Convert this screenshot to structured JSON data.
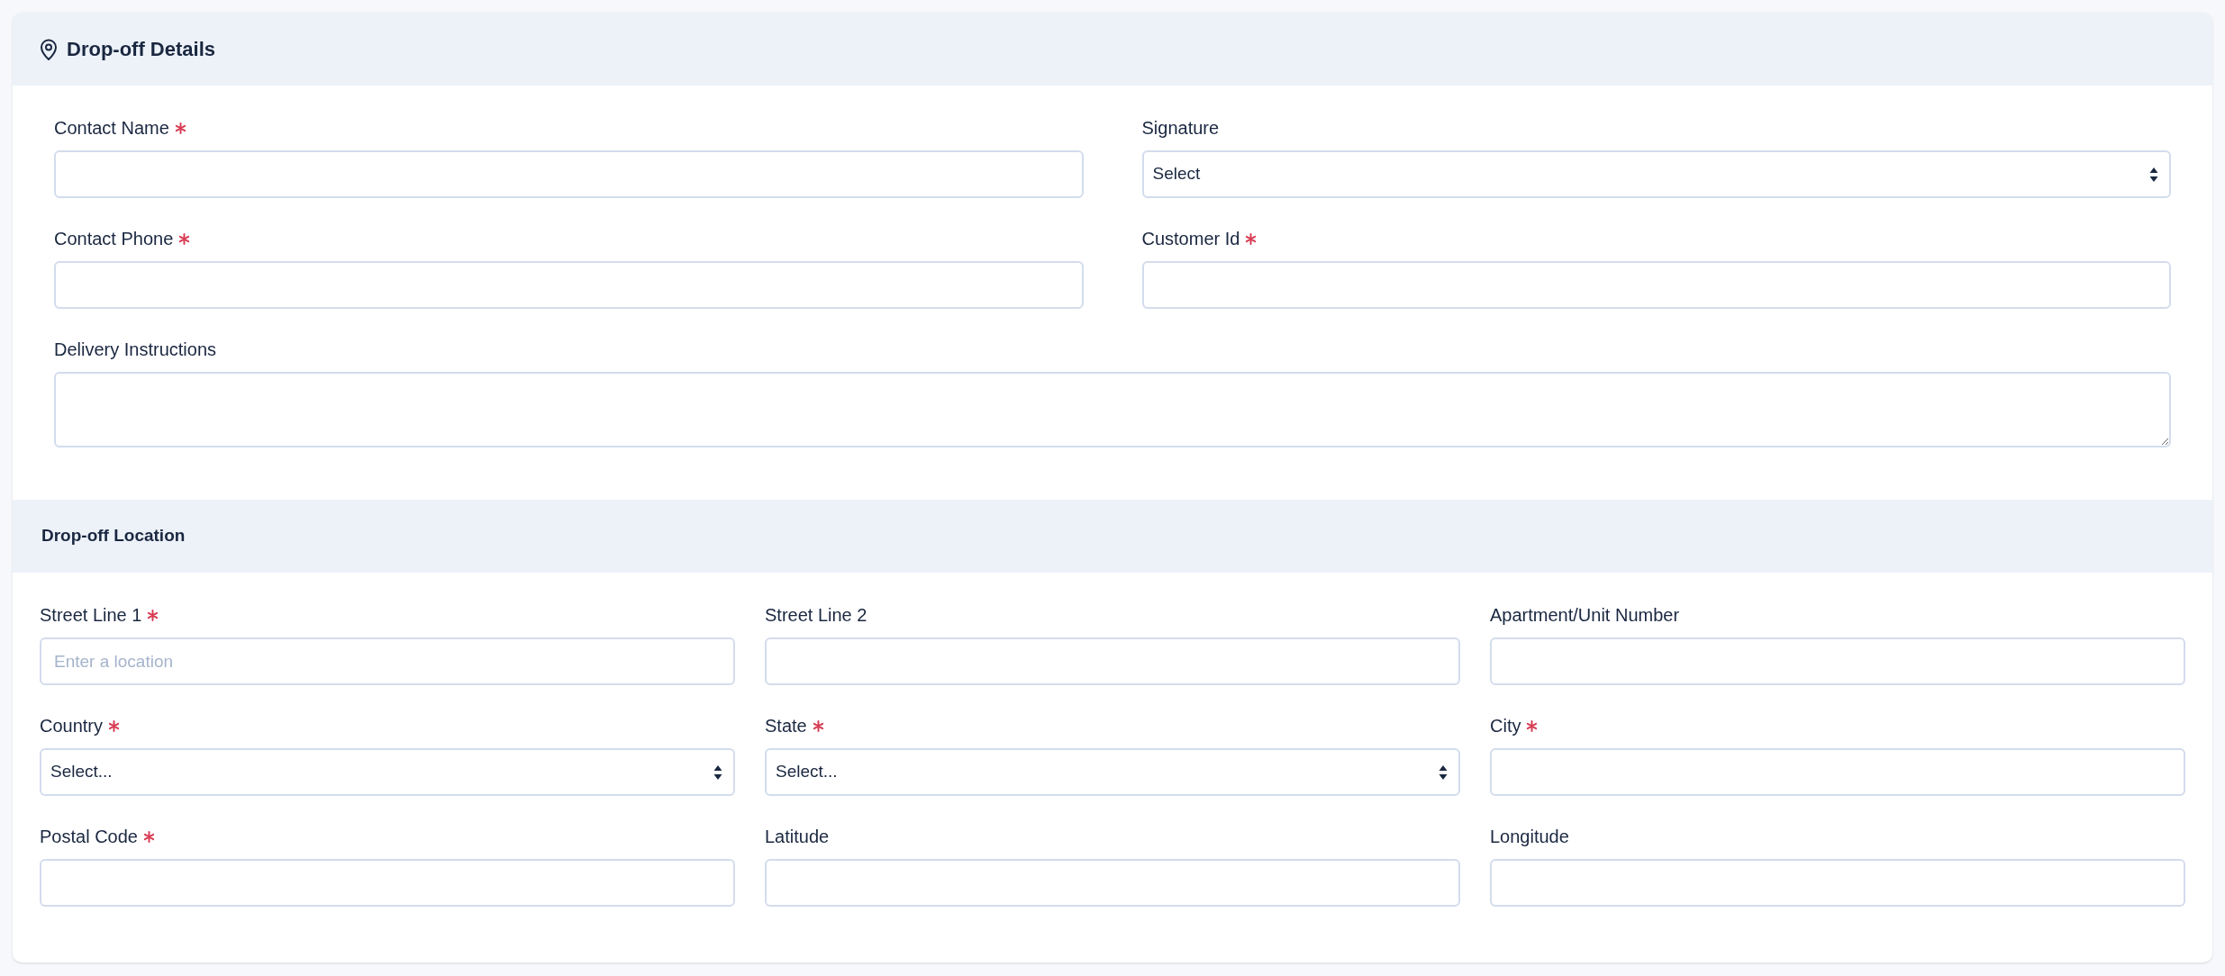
{
  "sections": [
    {
      "title": "Drop-off Details",
      "kind": "details",
      "fields": [
        {
          "label": "Contact Name",
          "required": true,
          "kind": "text"
        },
        {
          "label": "Signature",
          "required": false,
          "kind": "select",
          "value": "Select"
        },
        {
          "label": "Contact Phone",
          "required": true,
          "kind": "text"
        },
        {
          "label": "Customer Id",
          "required": true,
          "kind": "text"
        },
        {
          "label": "Delivery Instructions",
          "required": false,
          "kind": "textarea"
        }
      ]
    },
    {
      "title": "Drop-off Location",
      "kind": "location",
      "fields": [
        {
          "label": "Street Line 1",
          "required": true,
          "kind": "text",
          "placeholder": "Enter a location"
        },
        {
          "label": "Street Line 2",
          "required": false,
          "kind": "text"
        },
        {
          "label": "Apartment/Unit Number",
          "required": false,
          "kind": "text"
        },
        {
          "label": "Country",
          "required": true,
          "kind": "select",
          "value": "Select..."
        },
        {
          "label": "State",
          "required": true,
          "kind": "select",
          "value": "Select..."
        },
        {
          "label": "City",
          "required": true,
          "kind": "text"
        },
        {
          "label": "Postal Code",
          "required": true,
          "kind": "text"
        },
        {
          "label": "Latitude",
          "required": false,
          "kind": "text"
        },
        {
          "label": "Longitude",
          "required": false,
          "kind": "text"
        }
      ]
    }
  ]
}
